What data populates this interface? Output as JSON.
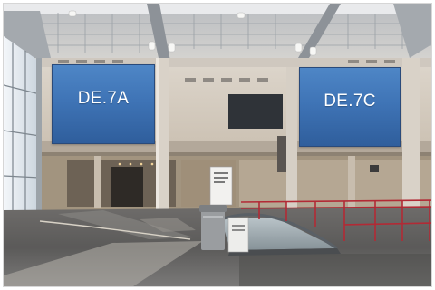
{
  "scene": {
    "signs": [
      {
        "text": "DE.7A",
        "color": "#3f74b6"
      },
      {
        "text": "DE.7C",
        "color": "#3f74b6"
      }
    ]
  }
}
